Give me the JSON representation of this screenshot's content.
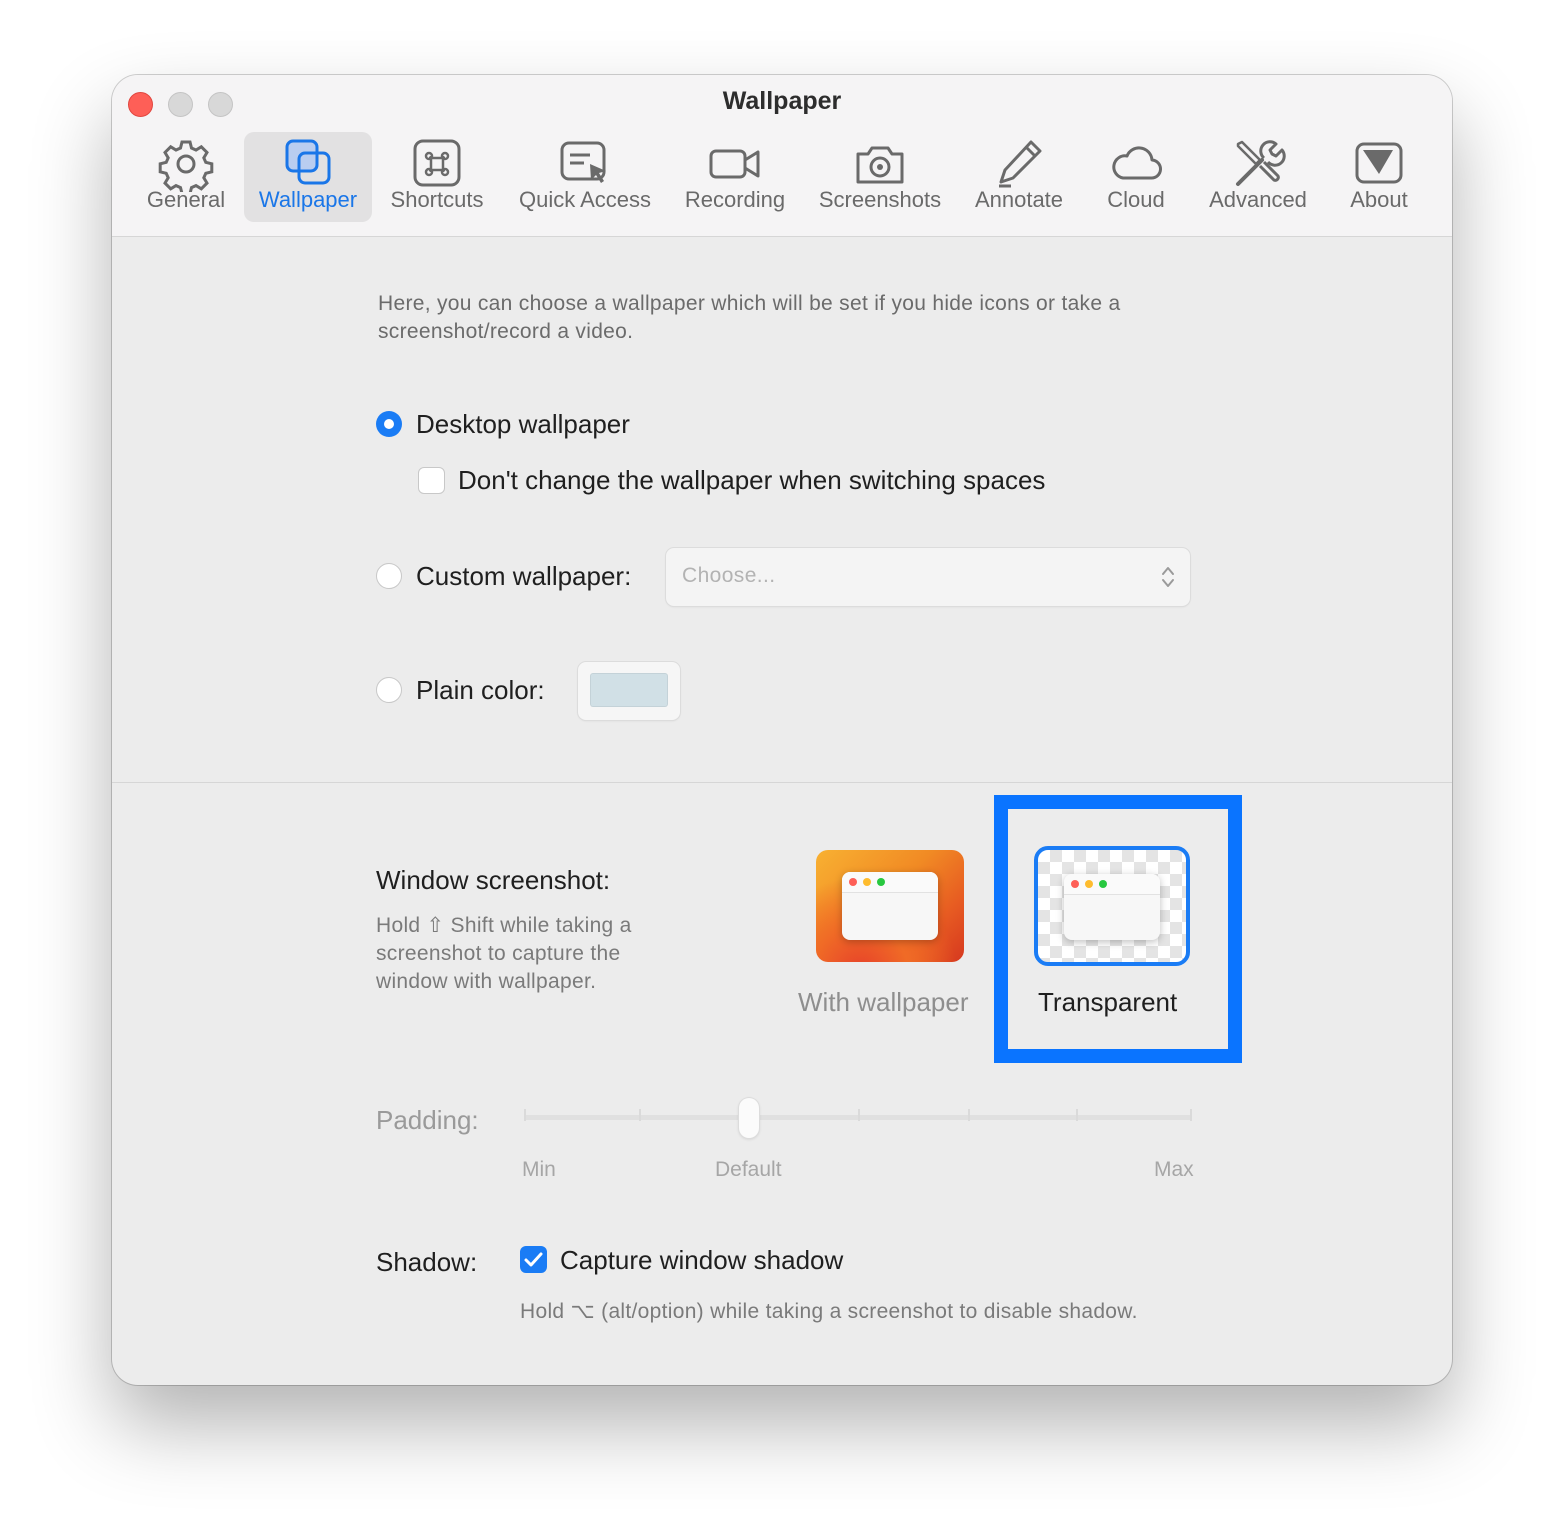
{
  "window": {
    "title": "Wallpaper"
  },
  "toolbar": {
    "items": [
      {
        "label": "General",
        "icon": "gear-icon"
      },
      {
        "label": "Wallpaper",
        "icon": "wallpaper-icon",
        "active": true
      },
      {
        "label": "Shortcuts",
        "icon": "command-key-icon"
      },
      {
        "label": "Quick Access",
        "icon": "quick-access-icon"
      },
      {
        "label": "Recording",
        "icon": "video-camera-icon"
      },
      {
        "label": "Screenshots",
        "icon": "camera-icon"
      },
      {
        "label": "Annotate",
        "icon": "pencil-icon"
      },
      {
        "label": "Cloud",
        "icon": "cloud-icon"
      },
      {
        "label": "Advanced",
        "icon": "tools-icon"
      },
      {
        "label": "About",
        "icon": "about-icon"
      }
    ]
  },
  "wallpaper": {
    "description": "Here, you can choose a wallpaper which will be set if you hide icons or take a screenshot/record a video.",
    "desktop_option": {
      "label": "Desktop wallpaper",
      "selected": true
    },
    "dont_change_checkbox": {
      "label": "Don't change the wallpaper when switching spaces",
      "checked": false
    },
    "custom_option": {
      "label": "Custom wallpaper:",
      "selected": false,
      "placeholder": "Choose..."
    },
    "plain_option": {
      "label": "Plain color:",
      "selected": false,
      "color": "#d1e0e6"
    }
  },
  "window_screenshot": {
    "title": "Window screenshot:",
    "note": "Hold ⇧ Shift while taking a screenshot to capture the window with wallpaper.",
    "options": [
      {
        "label": "With wallpaper",
        "selected": false
      },
      {
        "label": "Transparent",
        "selected": true
      }
    ]
  },
  "padding": {
    "label": "Padding:",
    "min_label": "Min",
    "default_label": "Default",
    "max_label": "Max",
    "value_fraction": 0.34
  },
  "shadow": {
    "label": "Shadow:",
    "checkbox_label": "Capture window shadow",
    "checked": true,
    "note": "Hold ⌥ (alt/option) while taking a screenshot to disable shadow."
  },
  "colors": {
    "accent": "#1a7cf5",
    "highlight": "#0a74ff"
  }
}
